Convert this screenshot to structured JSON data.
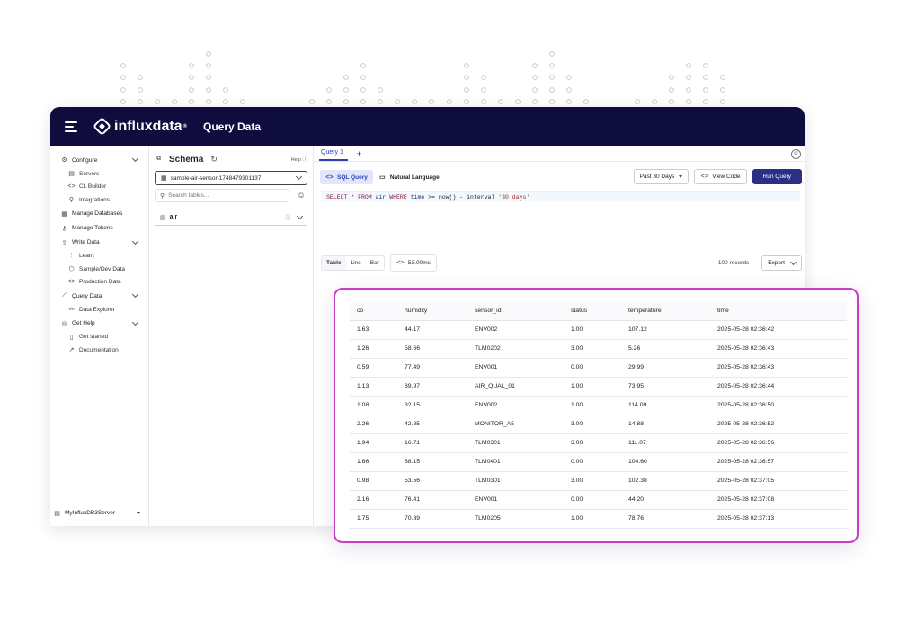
{
  "header": {
    "menu_icon": "collapse-menu-icon",
    "logo_text": "influxdata",
    "logo_mark": "®",
    "page_title": "Query Data"
  },
  "sidebar": {
    "sections": [
      {
        "label": "Configure",
        "icon": "gear-icon",
        "items": [
          {
            "label": "Servers",
            "icon": "server-icon"
          },
          {
            "label": "CL Builder",
            "icon": "code-icon"
          },
          {
            "label": "Integrations",
            "icon": "plug-icon"
          }
        ]
      },
      {
        "label": "Manage Databases",
        "icon": "database-icon",
        "items": []
      },
      {
        "label": "Manage Tokens",
        "icon": "key-icon",
        "items": []
      },
      {
        "label": "Write Data",
        "icon": "upload-icon",
        "items": [
          {
            "label": "Learn",
            "icon": "learn-icon"
          },
          {
            "label": "Sample/Dev Data",
            "icon": "cube-icon"
          },
          {
            "label": "Production Data",
            "icon": "code-icon"
          }
        ]
      },
      {
        "label": "Query Data",
        "icon": "chart-icon",
        "items": [
          {
            "label": "Data Explorer",
            "icon": "telescope-icon"
          }
        ]
      },
      {
        "label": "Get Help",
        "icon": "lifebuoy-icon",
        "items": [
          {
            "label": "Get started",
            "icon": "book-icon"
          },
          {
            "label": "Documentation",
            "icon": "external-link-icon"
          }
        ]
      }
    ],
    "server_selector": "MyInfluxDB3Server"
  },
  "schema": {
    "title": "Schema",
    "help": "Help",
    "database": "sample-air-sensor-1748479301137",
    "search_placeholder": "Search tables...",
    "tables": [
      "air"
    ]
  },
  "editor": {
    "tab_label": "Query 1",
    "add_tab": "+",
    "modes": [
      "SQL Query",
      "Natural Language"
    ],
    "time_range": "Past 30 Days",
    "view_code": "View Code",
    "run_query": "Run Query",
    "query": {
      "kw1": "SELECT * FROM",
      "table": " air ",
      "kw2": "WHERE",
      "col": " time ",
      "rest": ">= now() - interval ",
      "interval": "'30 days'"
    }
  },
  "results": {
    "views": [
      "Table",
      "Line",
      "Bar"
    ],
    "active_view": "Table",
    "duration": "53.00ms",
    "record_count": "100 records",
    "export_label": "Export",
    "columns": [
      "co",
      "humidity",
      "sensor_id",
      "status",
      "temperature",
      "time"
    ],
    "rows": [
      [
        "1.63",
        "44.17",
        "ENV002",
        "1.00",
        "107.12",
        "2025-05-28 02:36:42"
      ],
      [
        "1.26",
        "58.66",
        "TLM0202",
        "3.00",
        "5.26",
        "2025-05-28 02:36:43"
      ],
      [
        "0.59",
        "77.49",
        "ENV001",
        "0.00",
        "29.99",
        "2025-05-28 02:36:43"
      ],
      [
        "1.13",
        "89.97",
        "AIR_QUAL_01",
        "1.00",
        "73.95",
        "2025-05-28 02:36:44"
      ],
      [
        "1.08",
        "32.15",
        "ENV002",
        "1.00",
        "114.09",
        "2025-05-28 02:36:50"
      ],
      [
        "2.26",
        "42.85",
        "MONITOR_A5",
        "3.00",
        "14.88",
        "2025-05-28 02:36:52"
      ],
      [
        "1.94",
        "16.71",
        "TLM0301",
        "3.00",
        "111.07",
        "2025-05-28 02:36:56"
      ],
      [
        "1.86",
        "88.15",
        "TLM0401",
        "0.00",
        "104.60",
        "2025-05-28 02:36:57"
      ],
      [
        "0.98",
        "53.56",
        "TLM0301",
        "3.00",
        "102.38",
        "2025-05-28 02:37:05"
      ],
      [
        "2.16",
        "76.41",
        "ENV001",
        "0.00",
        "44.20",
        "2025-05-28 02:37:08"
      ],
      [
        "1.75",
        "70.39",
        "TLM0205",
        "1.00",
        "78.76",
        "2025-05-28 02:37:13"
      ]
    ]
  },
  "colors": {
    "topbar": "#0f0d3d",
    "accent": "#2b3eb8",
    "run_button": "#2b2f86",
    "highlight_border": "#c93cc4"
  }
}
